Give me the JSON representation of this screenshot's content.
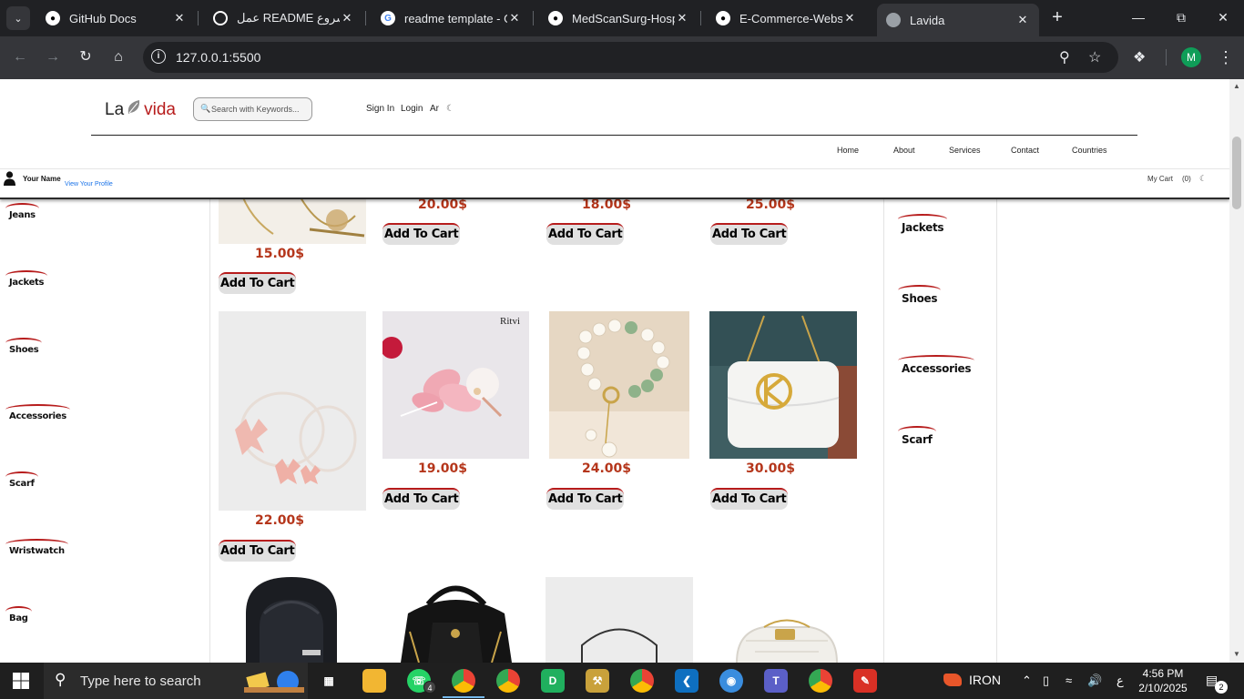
{
  "browser": {
    "tabs": [
      {
        "title": "GitHub Docs",
        "icon": "github-icon",
        "active": false
      },
      {
        "title": "عمل README لمشروع",
        "icon": "chatgpt-icon",
        "active": false
      },
      {
        "title": "readme template - Gc",
        "icon": "google-icon",
        "active": false
      },
      {
        "title": "MedScanSurg-Hospit",
        "icon": "github-icon",
        "active": false
      },
      {
        "title": "E-Commerce-Website",
        "icon": "github-icon",
        "active": false
      },
      {
        "title": "Lavida",
        "icon": "globe-icon",
        "active": true
      }
    ],
    "url": "127.0.0.1:5500",
    "profile_initial": "M"
  },
  "site": {
    "logo_left": "La",
    "logo_right": "vida",
    "search_placeholder": "Search with Keywords...",
    "top_links": {
      "sign_in": "Sign In",
      "login": "Login",
      "lang": "Ar"
    },
    "nav": [
      "Home",
      "About",
      "Services",
      "Contact",
      "Countries"
    ],
    "user": {
      "name": "Your Name",
      "profile_link": "View Your Profile"
    },
    "cart": {
      "label": "My Cart",
      "count": "(0)"
    }
  },
  "sidebar_left": [
    "Jeans",
    "Jackets",
    "Shoes",
    "Accessories",
    "Scarf",
    "Wristwatch",
    "Bag"
  ],
  "sidebar_right": [
    "Jackets",
    "Shoes",
    "Accessories",
    "Scarf"
  ],
  "products": {
    "cart_label": "Add To Cart",
    "row1_prices": [
      "15.00$",
      "20.00$",
      "18.00$",
      "25.00$"
    ],
    "row2_prices": [
      "22.00$",
      "19.00$",
      "24.00$",
      "30.00$"
    ],
    "row2_images": [
      "pink-bow-headband-image",
      "pink-flower-hairpin-image",
      "pearl-bracelet-image",
      "white-handbag-image"
    ],
    "row3_images": [
      "black-backpack-image",
      "black-mini-backpack-image",
      "grey-handbag-image",
      "white-quilted-bag-image"
    ],
    "brand_mark": "Ritvi"
  },
  "taskbar": {
    "search_placeholder": "Type here to search",
    "whatsapp_badge": "4",
    "app_label": "IRON",
    "time": "4:56 PM",
    "date": "2/10/2025",
    "lang": "ع",
    "notifications": "2"
  },
  "colors": {
    "brand_red": "#b71c1c",
    "price": "#b5361b"
  }
}
